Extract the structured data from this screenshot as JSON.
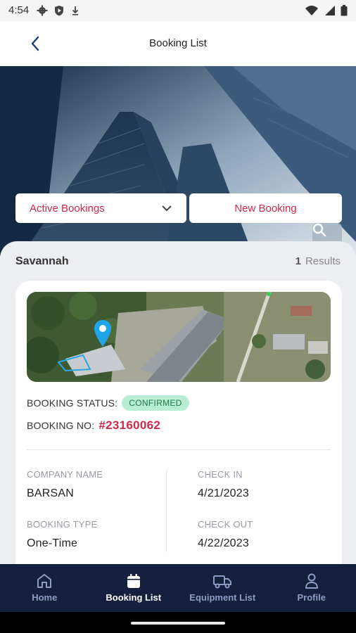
{
  "status_bar": {
    "time": "4:54"
  },
  "app_bar": {
    "title": "Booking List"
  },
  "filters": {
    "selected": "Active Bookings",
    "new_booking_label": "New Booking"
  },
  "list": {
    "location": "Savannah",
    "results_count": "1",
    "results_label": "Results"
  },
  "booking": {
    "status_label": "BOOKING STATUS:",
    "status_value": "CONFIRMED",
    "number_label": "BOOKING NO:",
    "number_value": "#23160062",
    "company_label": "COMPANY NAME",
    "company_value": "BARSAN",
    "type_label": "BOOKING TYPE",
    "type_value": "One-Time",
    "checkin_label": "CHECK IN",
    "checkin_value": "4/21/2023",
    "checkout_label": "CHECK OUT",
    "checkout_value": "4/22/2023"
  },
  "bottom_nav": {
    "items": [
      {
        "label": "Home",
        "icon": "home-icon",
        "active": false
      },
      {
        "label": "Booking List",
        "icon": "calendar-icon",
        "active": true
      },
      {
        "label": "Equipment List",
        "icon": "truck-icon",
        "active": false
      },
      {
        "label": "Profile",
        "icon": "person-icon",
        "active": false
      }
    ]
  },
  "colors": {
    "accent": "#d0284a",
    "nav_bg": "#15203f",
    "badge_bg": "#b8ecd4",
    "badge_text": "#1e7a4c"
  }
}
